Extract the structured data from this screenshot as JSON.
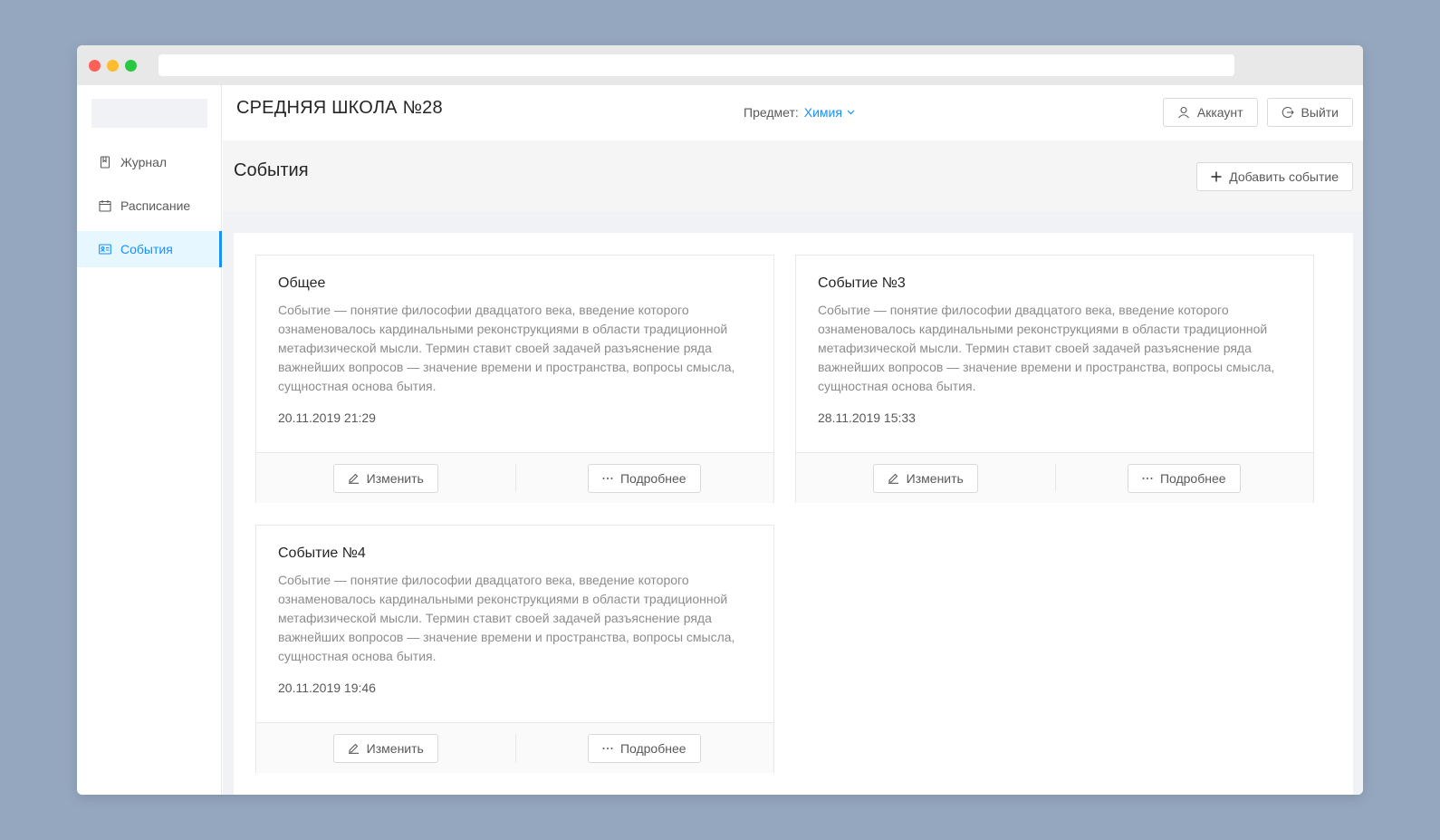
{
  "header": {
    "school_name": "СРЕДНЯЯ ШКОЛА №28",
    "subject_label": "Предмет:",
    "subject_value": "Химия",
    "account_button": "Аккаунт",
    "logout_button": "Выйти"
  },
  "sidebar": {
    "items": [
      {
        "label": "Журнал",
        "icon": "book-icon",
        "active": false
      },
      {
        "label": "Расписание",
        "icon": "calendar-icon",
        "active": false
      },
      {
        "label": "События",
        "icon": "id-card-icon",
        "active": true
      }
    ]
  },
  "page": {
    "title": "События",
    "add_button": "Добавить событие"
  },
  "events": [
    {
      "title": "Общее",
      "description": "Событие — понятие философии двадцатого века, введение которого ознаменовалось кардинальными реконструкциями в области традиционной метафизической мысли. Термин ставит своей задачей разъяснение ряда важнейших вопросов — значение времени и пространства, вопросы смысла, сущностная основа бытия.",
      "date": "20.11.2019 21:29",
      "edit_label": "Изменить",
      "more_label": "Подробнее"
    },
    {
      "title": "Событие №3",
      "description": "Событие — понятие философии двадцатого века, введение которого ознаменовалось кардинальными реконструкциями в области традиционной метафизической мысли. Термин ставит своей задачей разъяснение ряда важнейших вопросов — значение времени и пространства, вопросы смысла, сущностная основа бытия.",
      "date": "28.11.2019 15:33",
      "edit_label": "Изменить",
      "more_label": "Подробнее"
    },
    {
      "title": "Событие №4",
      "description": "Событие — понятие философии двадцатого века, введение которого ознаменовалось кардинальными реконструкциями в области традиционной метафизической мысли. Термин ставит своей задачей разъяснение ряда важнейших вопросов — значение времени и пространства, вопросы смысла, сущностная основа бытия.",
      "date": "20.11.2019 19:46",
      "edit_label": "Изменить",
      "more_label": "Подробнее"
    }
  ],
  "colors": {
    "accent": "#1890ff",
    "background": "#95a7bf",
    "active_menu_bg": "#e6f7ff"
  }
}
